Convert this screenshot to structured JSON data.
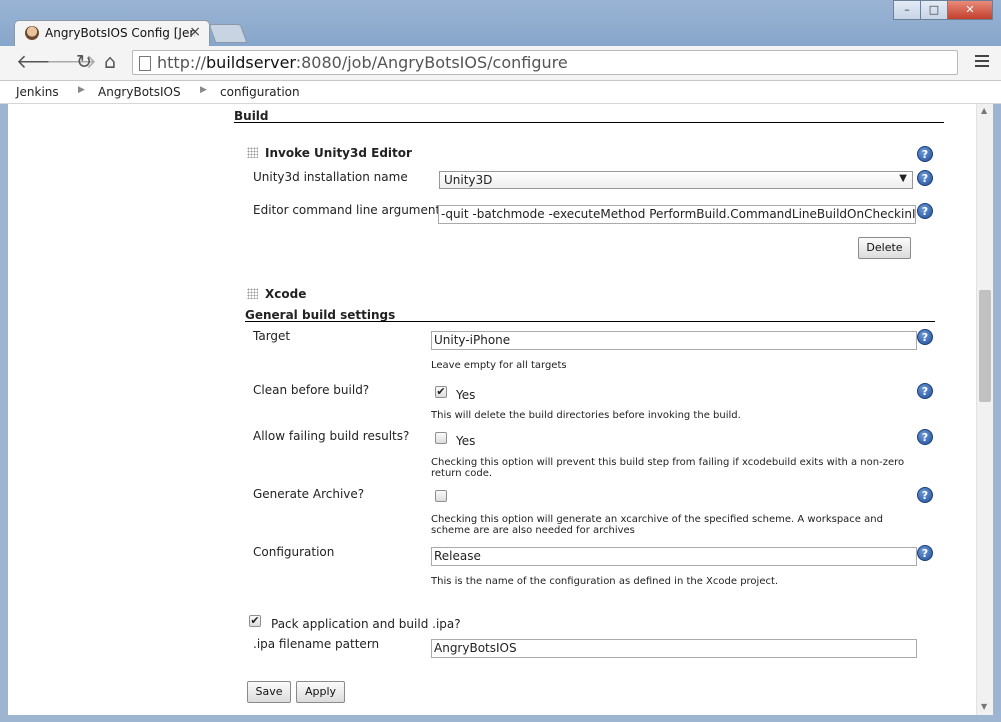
{
  "browser": {
    "tab_title": "AngryBotsIOS Config [Jenkins]",
    "url_scheme": "http://",
    "url_host": "buildserver",
    "url_rest": ":8080/job/AngryBotsIOS/configure"
  },
  "breadcrumb": [
    "Jenkins",
    "AngryBotsIOS",
    "configuration"
  ],
  "build": {
    "section_title": "Build",
    "unity": {
      "title": "Invoke Unity3d Editor",
      "installation_label": "Unity3d installation name",
      "installation_value": "Unity3D",
      "args_label": "Editor command line arguments",
      "args_value": "-quit -batchmode -executeMethod PerformBuild.CommandLineBuildOnCheckinIOS",
      "delete_label": "Delete"
    },
    "xcode": {
      "title": "Xcode",
      "general_title": "General build settings",
      "target_label": "Target",
      "target_value": "Unity-iPhone",
      "target_hint": "Leave empty for all targets",
      "clean_label": "Clean before build?",
      "clean_checked": true,
      "clean_option": "Yes",
      "clean_hint": "This will delete the build directories before invoking the build.",
      "failing_label": "Allow failing build results?",
      "failing_checked": false,
      "failing_option": "Yes",
      "failing_hint_1": "Checking this option will prevent this build step from failing if xcodebuild exits with a non-zero",
      "failing_hint_2": "return code.",
      "archive_label": "Generate Archive?",
      "archive_checked": false,
      "archive_hint_1": "Checking this option will generate an xcarchive of the specified scheme. A workspace and",
      "archive_hint_2": "scheme are are also needed for archives",
      "config_label": "Configuration",
      "config_value": "Release",
      "config_hint": "This is the name of the configuration as defined in the Xcode project.",
      "pack_label": "Pack application and build .ipa?",
      "pack_checked": true,
      "ipa_label": ".ipa filename pattern",
      "ipa_value": "AngryBotsIOS"
    }
  },
  "actions": {
    "save": "Save",
    "apply": "Apply"
  },
  "help_glyph": "?",
  "check_glyph": "✔"
}
